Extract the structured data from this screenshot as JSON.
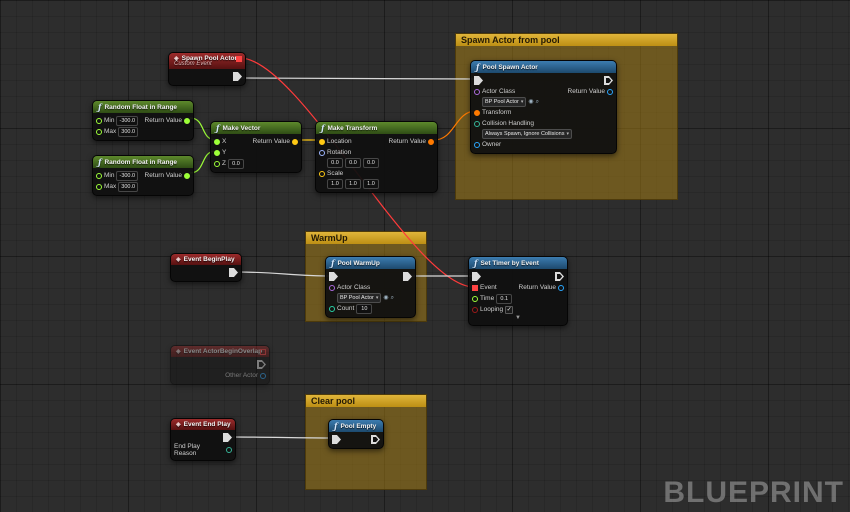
{
  "watermark": "BLUEPRINT",
  "icons": {
    "function_glyph": "ƒ",
    "event_glyph": "◈",
    "dropdown_arrow": "▾",
    "collapse_chevron": "▼",
    "check_glyph": "✓",
    "use_asset_icon": "◉",
    "browse_asset_icon": "⌕"
  },
  "colors": {
    "background": "#2d2d2d",
    "comment_header": "#cd9c1c",
    "event_header": "#9c2b2b",
    "pure_function_header": "#5d8a2c",
    "function_header": "#3c7cb0",
    "exec_pin": "#dcdcdc",
    "float_pin": "#9dff38",
    "vector_pin": "#ffc914",
    "transform_pin": "#ff7a00",
    "rotator_pin": "#9fb7ff",
    "object_pin": "#2aa7ff",
    "class_pin": "#ad6bdf",
    "bool_pin": "#9e1a1a",
    "enum_pin": "#36b699",
    "int_pin": "#27d0a5",
    "delegate_pin": "#ff4343"
  },
  "comments": {
    "spawn": {
      "title": "Spawn Actor from pool"
    },
    "warmup": {
      "title": "WarmUp"
    },
    "clear": {
      "title": "Clear pool"
    }
  },
  "nodes": {
    "custom_event": {
      "title": "Spawn Pool Actor",
      "subtitle": "Custom Event"
    },
    "random1": {
      "title": "Random Float in Range",
      "min_label": "Min",
      "min_value": "-300.0",
      "max_label": "Max",
      "max_value": "300.0",
      "return_label": "Return Value"
    },
    "random2": {
      "title": "Random Float in Range",
      "min_label": "Min",
      "min_value": "-300.0",
      "max_label": "Max",
      "max_value": "300.0",
      "return_label": "Return Value"
    },
    "make_vector": {
      "title": "Make Vector",
      "x_label": "X",
      "y_label": "Y",
      "z_label": "Z",
      "z_value": "0.0",
      "return_label": "Return Value"
    },
    "make_transform": {
      "title": "Make Transform",
      "location_label": "Location",
      "rotation_label": "Rotation",
      "scale_label": "Scale",
      "rotation_values": [
        "0.0",
        "0.0",
        "0.0"
      ],
      "scale_values": [
        "1.0",
        "1.0",
        "1.0"
      ],
      "return_label": "Return Value"
    },
    "pool_spawn": {
      "title": "Pool Spawn Actor",
      "actor_class_label": "Actor Class",
      "actor_class_value": "BP Pool Actor",
      "transform_label": "Transform",
      "collision_label": "Collision Handling",
      "collision_value": "Always Spawn, Ignore Collisions",
      "owner_label": "Owner",
      "return_label": "Return Value"
    },
    "begin_play": {
      "title": "Event BeginPlay"
    },
    "pool_warmup": {
      "title": "Pool WarmUp",
      "actor_class_label": "Actor Class",
      "actor_class_value": "BP Pool Actor",
      "count_label": "Count",
      "count_value": "10"
    },
    "set_timer": {
      "title": "Set Timer by Event",
      "event_label": "Event",
      "time_label": "Time",
      "time_value": "0.1",
      "looping_label": "Looping",
      "return_label": "Return Value"
    },
    "overlap": {
      "title": "Event ActorBeginOverlap",
      "other_actor_label": "Other Actor"
    },
    "end_play": {
      "title": "Event End Play",
      "reason_label": "End Play Reason"
    },
    "pool_empty": {
      "title": "Pool Empty"
    }
  }
}
